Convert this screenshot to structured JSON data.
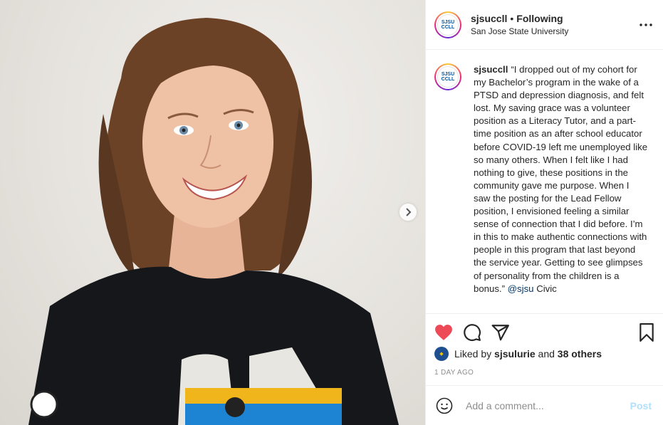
{
  "post": {
    "username": "sjsuccll",
    "follow_status": "Following",
    "location": "San Jose State University",
    "avatar_text": "SJSU CCLL",
    "caption_user": "sjsuccll",
    "caption_text": "“I dropped out of my cohort for my Bachelor’s program in the wake of a PTSD and depression diagnosis, and felt lost. My saving grace was a volunteer position as a Literacy Tutor, and a part-time position as an after school educator before COVID-19 left me unemployed like so many others. When I felt like I had nothing to give, these positions in the community gave me purpose. When I saw the posting for the Lead Fellow position, I envisioned feeling a similar sense of connection that I did before. I’m in this to make authentic connections with people in this program that last beyond the service year. Getting to see glimpses of personality from the children is a bonus.”",
    "caption_mention": "@sjsu",
    "caption_tail": "Civic",
    "likes_prefix": "Liked by",
    "likes_user": "sjsulurie",
    "likes_and": "and",
    "likes_others": "38 others",
    "time_ago": "1 DAY AGO",
    "liked": true
  },
  "comment": {
    "placeholder": "Add a comment...",
    "post_label": "Post"
  },
  "icons": {
    "more": "more-options-icon",
    "next": "chevron-right-icon",
    "like": "heart-icon",
    "comment": "comment-icon",
    "share": "paper-plane-icon",
    "save": "bookmark-icon",
    "emoji": "smiley-icon"
  },
  "colors": {
    "heart": "#ed4956",
    "post_disabled": "#b2dffc",
    "mention": "#00376b",
    "muted": "#8e8e8e"
  }
}
